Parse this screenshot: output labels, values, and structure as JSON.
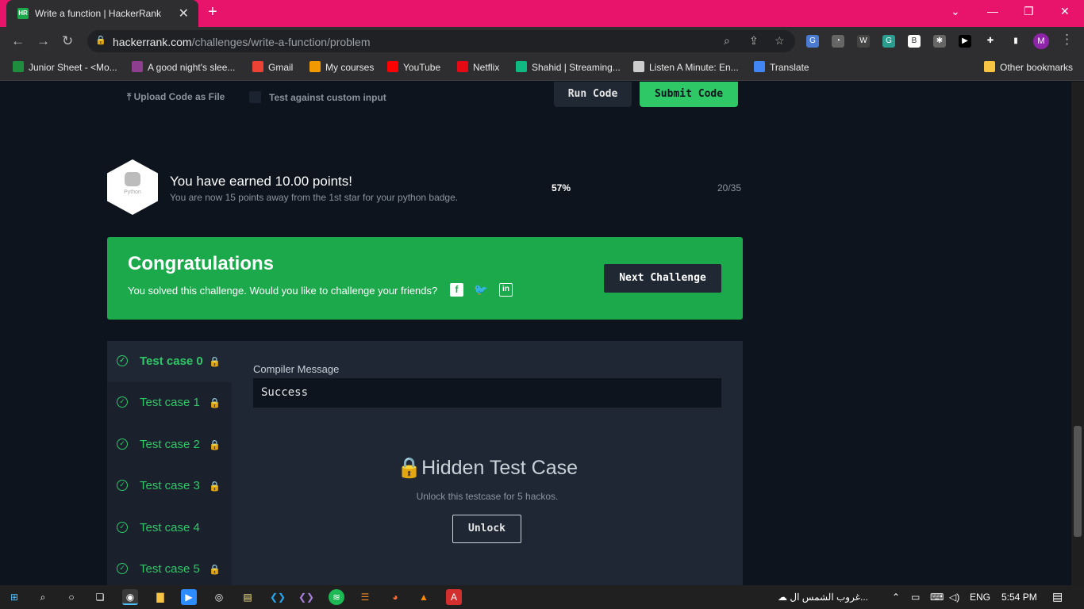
{
  "browser": {
    "tab_title": "Write a function | HackerRank",
    "tab_favicon": "HR",
    "close_label": "✕",
    "new_tab_label": "+",
    "url_host": "hackerrank.com",
    "url_path": "/challenges/write-a-function/problem",
    "avatar_initial": "M",
    "bookmarks": [
      "Junior Sheet - <Mo...",
      "A good night's slee...",
      "Gmail",
      "My courses",
      "YouTube",
      "Netflix",
      "Shahid | Streaming...",
      "Listen A Minute: En...",
      "Translate",
      "Other bookmarks"
    ]
  },
  "editor_bar": {
    "upload_label": "Upload Code as File",
    "custom_input_label": "Test against custom input",
    "run_label": "Run Code",
    "submit_label": "Submit Code"
  },
  "badge": {
    "badge_name": "Python",
    "earned_text": "You have earned 10.00 points!",
    "progress_text": "You are now 15 points away from the 1st star for your python badge.",
    "percent_text": "57%",
    "fraction_text": "20/35"
  },
  "congrats": {
    "title": "Congratulations",
    "message": "You solved this challenge. Would you like to challenge your friends?",
    "next_label": "Next Challenge"
  },
  "test_cases": [
    {
      "label": "Test case 0",
      "locked": true,
      "active": true
    },
    {
      "label": "Test case 1",
      "locked": true,
      "active": false
    },
    {
      "label": "Test case 2",
      "locked": true,
      "active": false
    },
    {
      "label": "Test case 3",
      "locked": true,
      "active": false
    },
    {
      "label": "Test case 4",
      "locked": false,
      "active": false
    },
    {
      "label": "Test case 5",
      "locked": true,
      "active": false
    }
  ],
  "result": {
    "compiler_label": "Compiler Message",
    "compiler_value": "Success",
    "hidden_title": "Hidden Test Case",
    "hidden_sub": "Unlock this testcase for 5 hackos.",
    "unlock_label": "Unlock"
  },
  "taskbar": {
    "weather_text": "غروب الشمس ال...",
    "lang": "ENG",
    "time": "5:54 PM"
  },
  "colors": {
    "accent_green": "#1ba94c",
    "titlebar": "#e8146c",
    "background": "#0e141e"
  }
}
